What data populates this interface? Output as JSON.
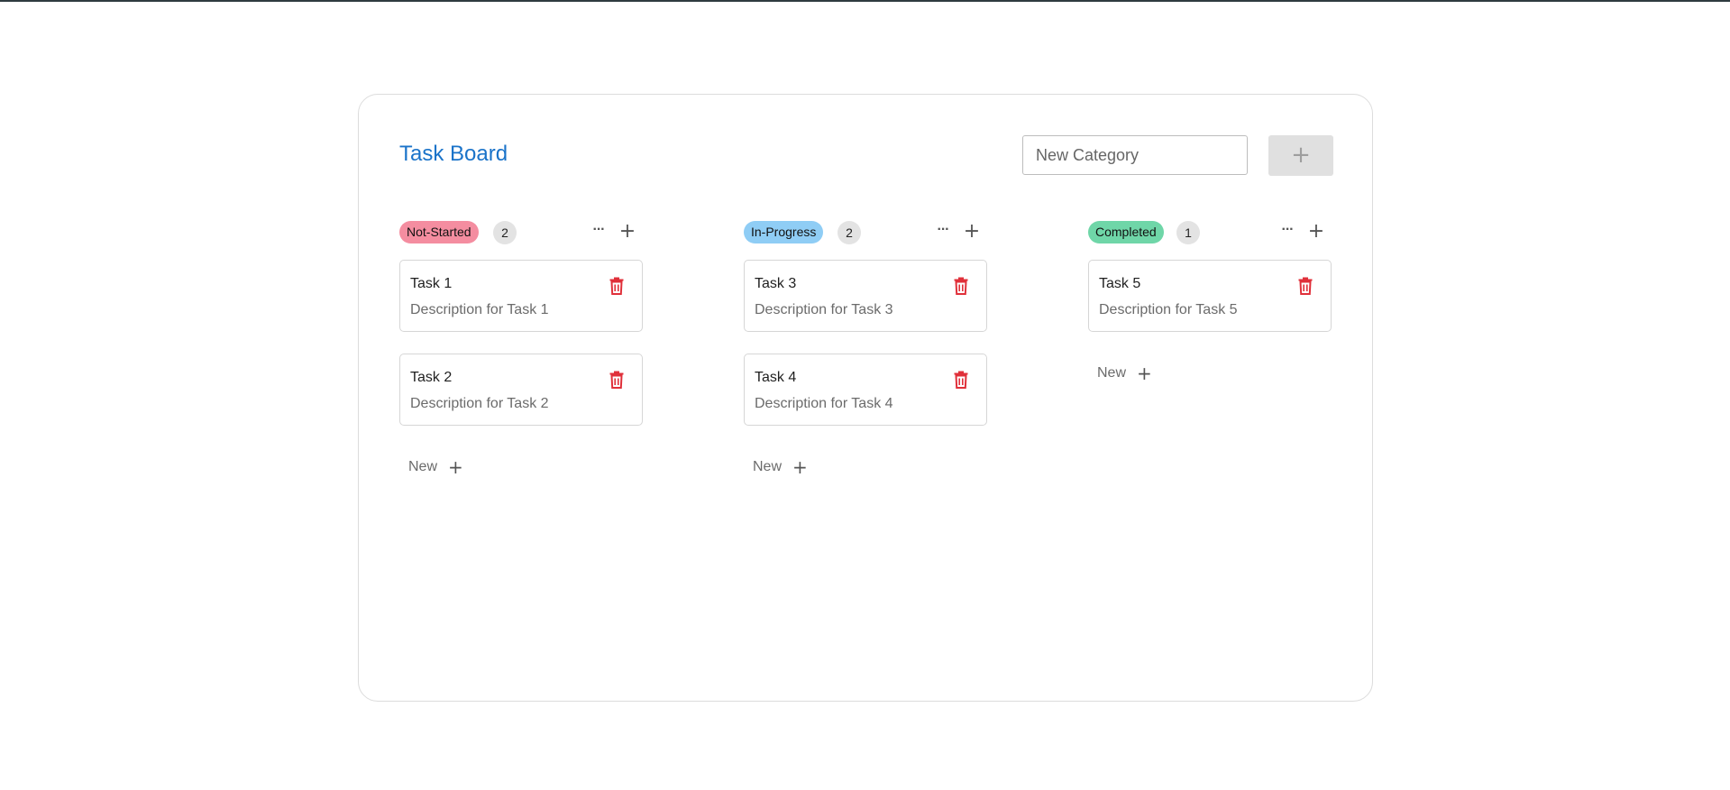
{
  "board": {
    "title": "Task Board",
    "new_category_placeholder": "New Category",
    "add_category_label": "+"
  },
  "columns": [
    {
      "status": "Not-Started",
      "status_color": "#f48da0",
      "count": "2",
      "menu_label": "···",
      "add_label": "+",
      "tasks": [
        {
          "title": "Task 1",
          "description": "Description for Task 1"
        },
        {
          "title": "Task 2",
          "description": "Description for Task 2"
        }
      ],
      "new_label": "New",
      "new_plus": "+"
    },
    {
      "status": "In-Progress",
      "status_color": "#8fcdf5",
      "count": "2",
      "menu_label": "···",
      "add_label": "+",
      "tasks": [
        {
          "title": "Task 3",
          "description": "Description for Task 3"
        },
        {
          "title": "Task 4",
          "description": "Description for Task 4"
        }
      ],
      "new_label": "New",
      "new_plus": "+"
    },
    {
      "status": "Completed",
      "status_color": "#6fd6a8",
      "count": "1",
      "menu_label": "···",
      "add_label": "+",
      "tasks": [
        {
          "title": "Task 5",
          "description": "Description for Task 5"
        }
      ],
      "new_label": "New",
      "new_plus": "+"
    }
  ],
  "colors": {
    "title": "#1a73c9",
    "delete_icon": "#e0303a"
  },
  "icons": {
    "delete": "trash-icon",
    "menu": "ellipsis-icon",
    "add": "plus-icon"
  }
}
